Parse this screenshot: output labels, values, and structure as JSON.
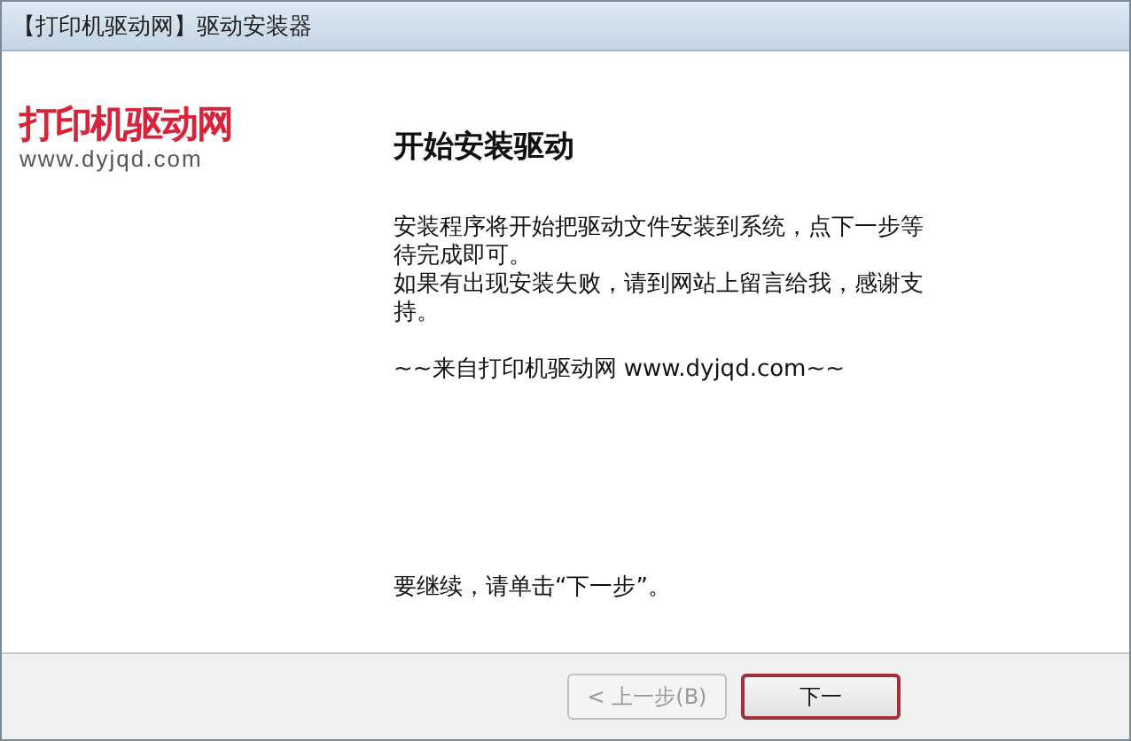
{
  "window": {
    "title": "【打印机驱动网】驱动安装器"
  },
  "logo": {
    "name": "打印机驱动网",
    "url": "www.dyjqd.com"
  },
  "heading": "开始安装驱动",
  "paragraphs": [
    "安装程序将开始把驱动文件安装到系统，点下一步等待完成即可。",
    "如果有出现安装失败，请到网站上留言给我，感谢支持。"
  ],
  "signature": "~~来自打印机驱动网 www.dyjqd.com~~",
  "continue_hint": "要继续，请单击“下一步”。",
  "buttons": [
    {
      "label": "< 上一步(B)",
      "disabled": true,
      "default": false
    },
    {
      "label": "下一",
      "disabled": false,
      "default": true
    }
  ]
}
